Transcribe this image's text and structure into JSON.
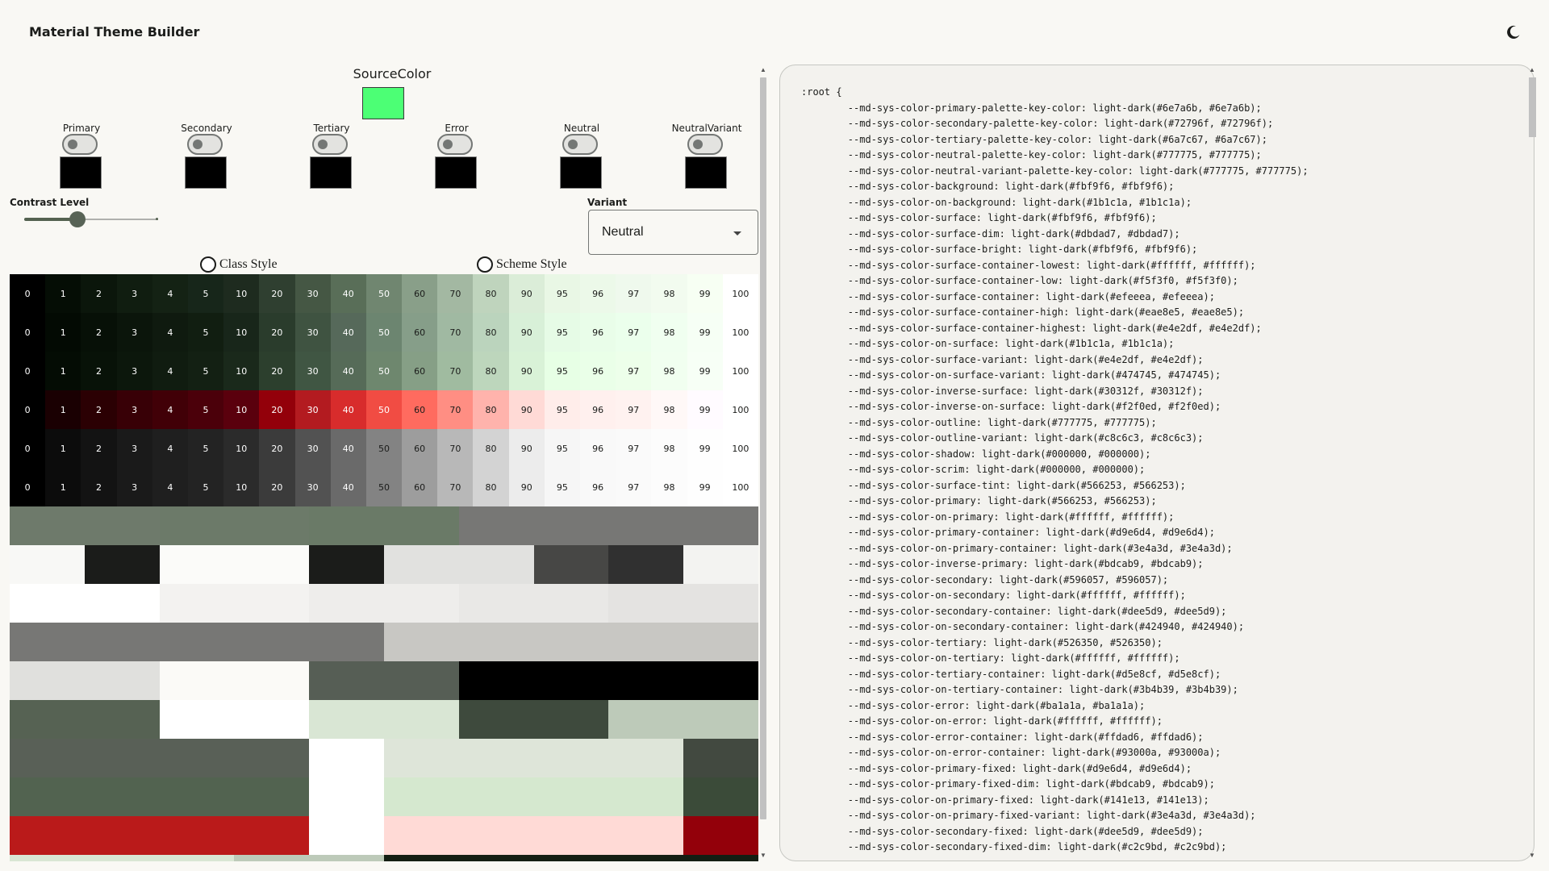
{
  "app": {
    "title": "Material Theme Builder",
    "theme_toggle_icon": "moon-icon"
  },
  "source": {
    "label": "SourceColor",
    "color": "#4cff75"
  },
  "color_groups": [
    {
      "label": "Primary",
      "swatch": "#000000"
    },
    {
      "label": "Secondary",
      "swatch": "#000000"
    },
    {
      "label": "Tertiary",
      "swatch": "#000000"
    },
    {
      "label": "Error",
      "swatch": "#000000"
    },
    {
      "label": "Neutral",
      "swatch": "#000000"
    },
    {
      "label": "NeutralVariant",
      "swatch": "#000000"
    }
  ],
  "contrast": {
    "label": "Contrast Level",
    "value": 0.4
  },
  "variant": {
    "label": "Variant",
    "value": "Neutral"
  },
  "style_options": {
    "class_style": "Class Style",
    "scheme_style": "Scheme Style"
  },
  "tones": [
    "0",
    "1",
    "2",
    "3",
    "4",
    "5",
    "10",
    "20",
    "30",
    "40",
    "50",
    "60",
    "70",
    "80",
    "90",
    "95",
    "96",
    "97",
    "98",
    "99",
    "100"
  ],
  "palette_rows": [
    {
      "name": "primary",
      "colors": [
        "#000000",
        "#050d05",
        "#0b160b",
        "#101d10",
        "#142214",
        "#17261a",
        "#1e2b1f",
        "#2f3f30",
        "#455744",
        "#596e58",
        "#708670",
        "#899f89",
        "#a3b8a2",
        "#bfd4bd",
        "#dbedd8",
        "#e9f7e5",
        "#ecf9e9",
        "#eff9ed",
        "#f2fbef",
        "#f7fff3",
        "#ffffff"
      ]
    },
    {
      "name": "secondary",
      "colors": [
        "#000000",
        "#030a03",
        "#071007",
        "#0b150b",
        "#0f1a0f",
        "#111e11",
        "#18261a",
        "#2a3c2c",
        "#3f5341",
        "#56695a",
        "#6c8570",
        "#869e89",
        "#a0b9a2",
        "#bbd4bd",
        "#d8f0d8",
        "#e6fbe6",
        "#e9fde9",
        "#ebffec",
        "#f0fff0",
        "#f6fff5",
        "#ffffff"
      ]
    },
    {
      "name": "tertiary",
      "colors": [
        "#000000",
        "#040c04",
        "#081208",
        "#0c170c",
        "#101c10",
        "#132013",
        "#1a291b",
        "#2c3f2d",
        "#405643",
        "#566b58",
        "#6e876e",
        "#869f86",
        "#a0bba0",
        "#bdd6bc",
        "#d9f2d7",
        "#e7ffe5",
        "#eaffe8",
        "#edffea",
        "#f1fff0",
        "#f7fff6",
        "#ffffff"
      ]
    },
    {
      "name": "error",
      "colors": [
        "#000000",
        "#1a0002",
        "#2b0003",
        "#380006",
        "#410007",
        "#4b000a",
        "#5a000d",
        "#93000a",
        "#b31b20",
        "#d82c2c",
        "#f14c43",
        "#ff6b5f",
        "#ff8e83",
        "#ffb3ac",
        "#ffdad6",
        "#ffedea",
        "#fff0ee",
        "#fff2f0",
        "#fff8f7",
        "#fffbff",
        "#ffffff"
      ]
    },
    {
      "name": "neutral",
      "colors": [
        "#000000",
        "#0c0c0c",
        "#131313",
        "#1a1a1a",
        "#1f1f1f",
        "#232323",
        "#2b2b2b",
        "#3b3b3b",
        "#525252",
        "#6a6a6a",
        "#838383",
        "#9d9d9d",
        "#b8b8b8",
        "#d3d3d3",
        "#ececec",
        "#f6f6f6",
        "#f9f9f9",
        "#fafafa",
        "#fcfcfc",
        "#fefefe",
        "#ffffff"
      ]
    },
    {
      "name": "neutral_variant",
      "colors": [
        "#000000",
        "#0c0c0c",
        "#131313",
        "#1a1a1a",
        "#1f1f1f",
        "#232323",
        "#2b2b2b",
        "#3b3b3b",
        "#525252",
        "#6a6a6a",
        "#838383",
        "#9d9d9d",
        "#b8b8b8",
        "#d3d3d3",
        "#ececec",
        "#f6f6f6",
        "#f9f9f9",
        "#fafafa",
        "#fcfcfc",
        "#fefefe",
        "#ffffff"
      ]
    }
  ],
  "block_rows": [
    [
      [
        "#6e7a6b",
        4
      ],
      [
        "#6c7a69",
        4
      ],
      [
        "#6a7a67",
        4
      ],
      [
        "#777775",
        8
      ]
    ],
    [
      [
        "#f8f8f6",
        2
      ],
      [
        "#1b1c1a",
        2
      ],
      [
        "#fbfbf9",
        4
      ],
      [
        "#1b1c1a",
        2
      ],
      [
        "#e1e1df",
        4
      ],
      [
        "#474745",
        2
      ],
      [
        "#303030",
        2
      ],
      [
        "#f3f3f1",
        2
      ]
    ],
    [
      [
        "#ffffff",
        4
      ],
      [
        "#f3f2f0",
        4
      ],
      [
        "#eeedeb",
        4
      ],
      [
        "#e9e8e6",
        4
      ],
      [
        "#e4e3e1",
        4
      ]
    ],
    [
      [
        "#777775",
        10
      ],
      [
        "#c8c7c3",
        10
      ]
    ],
    [
      [
        "#e0e0dd",
        4
      ],
      [
        "#fbfaf7",
        4
      ],
      [
        "#565e55",
        4
      ],
      [
        "#000000",
        8
      ]
    ],
    [
      [
        "#566253",
        4
      ],
      [
        "#ffffff",
        4
      ],
      [
        "#d9e6d4",
        4
      ],
      [
        "#3e4a3d",
        4
      ],
      [
        "#bdcab9",
        4
      ]
    ],
    [
      [
        "#596057",
        8
      ],
      [
        "#ffffff",
        2
      ],
      [
        "#dee5d9",
        8
      ],
      [
        "#424940",
        2
      ]
    ],
    [
      [
        "#526350",
        8
      ],
      [
        "#ffffff",
        2
      ],
      [
        "#d5e8cf",
        8
      ],
      [
        "#3b4b39",
        2
      ]
    ],
    [
      [
        "#ba1a1a",
        8
      ],
      [
        "#ffffff",
        2
      ],
      [
        "#ffdad6",
        8
      ],
      [
        "#93000a",
        2
      ]
    ],
    [
      [
        "#d9e6d4",
        6
      ],
      [
        "#bdcab9",
        4
      ],
      [
        "#141e13",
        10
      ]
    ]
  ],
  "code_lines": [
    ":root {",
    "        --md-sys-color-primary-palette-key-color: light-dark(#6e7a6b, #6e7a6b);",
    "        --md-sys-color-secondary-palette-key-color: light-dark(#72796f, #72796f);",
    "        --md-sys-color-tertiary-palette-key-color: light-dark(#6a7c67, #6a7c67);",
    "        --md-sys-color-neutral-palette-key-color: light-dark(#777775, #777775);",
    "        --md-sys-color-neutral-variant-palette-key-color: light-dark(#777775, #777775);",
    "        --md-sys-color-background: light-dark(#fbf9f6, #fbf9f6);",
    "        --md-sys-color-on-background: light-dark(#1b1c1a, #1b1c1a);",
    "        --md-sys-color-surface: light-dark(#fbf9f6, #fbf9f6);",
    "        --md-sys-color-surface-dim: light-dark(#dbdad7, #dbdad7);",
    "        --md-sys-color-surface-bright: light-dark(#fbf9f6, #fbf9f6);",
    "        --md-sys-color-surface-container-lowest: light-dark(#ffffff, #ffffff);",
    "        --md-sys-color-surface-container-low: light-dark(#f5f3f0, #f5f3f0);",
    "        --md-sys-color-surface-container: light-dark(#efeeea, #efeeea);",
    "        --md-sys-color-surface-container-high: light-dark(#eae8e5, #eae8e5);",
    "        --md-sys-color-surface-container-highest: light-dark(#e4e2df, #e4e2df);",
    "        --md-sys-color-on-surface: light-dark(#1b1c1a, #1b1c1a);",
    "        --md-sys-color-surface-variant: light-dark(#e4e2df, #e4e2df);",
    "        --md-sys-color-on-surface-variant: light-dark(#474745, #474745);",
    "        --md-sys-color-inverse-surface: light-dark(#30312f, #30312f);",
    "        --md-sys-color-inverse-on-surface: light-dark(#f2f0ed, #f2f0ed);",
    "        --md-sys-color-outline: light-dark(#777775, #777775);",
    "        --md-sys-color-outline-variant: light-dark(#c8c6c3, #c8c6c3);",
    "        --md-sys-color-shadow: light-dark(#000000, #000000);",
    "        --md-sys-color-scrim: light-dark(#000000, #000000);",
    "        --md-sys-color-surface-tint: light-dark(#566253, #566253);",
    "        --md-sys-color-primary: light-dark(#566253, #566253);",
    "        --md-sys-color-on-primary: light-dark(#ffffff, #ffffff);",
    "        --md-sys-color-primary-container: light-dark(#d9e6d4, #d9e6d4);",
    "        --md-sys-color-on-primary-container: light-dark(#3e4a3d, #3e4a3d);",
    "        --md-sys-color-inverse-primary: light-dark(#bdcab9, #bdcab9);",
    "        --md-sys-color-secondary: light-dark(#596057, #596057);",
    "        --md-sys-color-on-secondary: light-dark(#ffffff, #ffffff);",
    "        --md-sys-color-secondary-container: light-dark(#dee5d9, #dee5d9);",
    "        --md-sys-color-on-secondary-container: light-dark(#424940, #424940);",
    "        --md-sys-color-tertiary: light-dark(#526350, #526350);",
    "        --md-sys-color-on-tertiary: light-dark(#ffffff, #ffffff);",
    "        --md-sys-color-tertiary-container: light-dark(#d5e8cf, #d5e8cf);",
    "        --md-sys-color-on-tertiary-container: light-dark(#3b4b39, #3b4b39);",
    "        --md-sys-color-error: light-dark(#ba1a1a, #ba1a1a);",
    "        --md-sys-color-on-error: light-dark(#ffffff, #ffffff);",
    "        --md-sys-color-error-container: light-dark(#ffdad6, #ffdad6);",
    "        --md-sys-color-on-error-container: light-dark(#93000a, #93000a);",
    "        --md-sys-color-primary-fixed: light-dark(#d9e6d4, #d9e6d4);",
    "        --md-sys-color-primary-fixed-dim: light-dark(#bdcab9, #bdcab9);",
    "        --md-sys-color-on-primary-fixed: light-dark(#141e13, #141e13);",
    "        --md-sys-color-on-primary-fixed-variant: light-dark(#3e4a3d, #3e4a3d);",
    "        --md-sys-color-secondary-fixed: light-dark(#dee5d9, #dee5d9);",
    "        --md-sys-color-secondary-fixed-dim: light-dark(#c2c9bd, #c2c9bd);"
  ]
}
